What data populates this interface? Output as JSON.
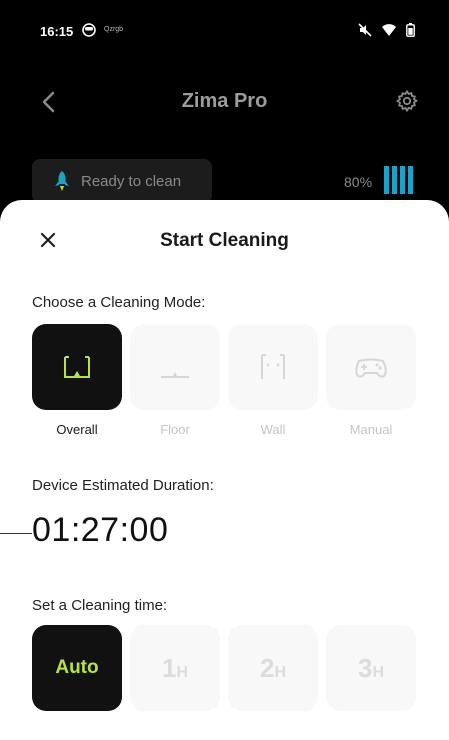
{
  "status_bar": {
    "time": "16:15",
    "carrier": "Qzrgb"
  },
  "header": {
    "title": "Zima Pro"
  },
  "device": {
    "status": "Ready to clean",
    "battery": "80%",
    "battery_level": 0.8
  },
  "sheet": {
    "title": "Start Cleaning",
    "mode_label": "Choose a Cleaning Mode:",
    "modes": [
      {
        "label": "Overall",
        "icon": "overall-mode-icon",
        "active": true
      },
      {
        "label": "Floor",
        "icon": "floor-mode-icon",
        "active": false
      },
      {
        "label": "Wall",
        "icon": "wall-mode-icon",
        "active": false
      },
      {
        "label": "Manual",
        "icon": "gamepad-icon",
        "active": false
      }
    ],
    "duration_label": "Device Estimated Duration:",
    "duration": "01:27:00",
    "time_label": "Set a Cleaning time:",
    "times": [
      {
        "label": "Auto",
        "active": true
      },
      {
        "number": "1",
        "unit": "H",
        "active": false
      },
      {
        "number": "2",
        "unit": "H",
        "active": false
      },
      {
        "number": "3",
        "unit": "H",
        "active": false
      }
    ]
  },
  "colors": {
    "accent": "#b6e340",
    "battery": "#1aa3c9",
    "sheet_bg": "#ffffff",
    "active_tile": "#111111"
  }
}
